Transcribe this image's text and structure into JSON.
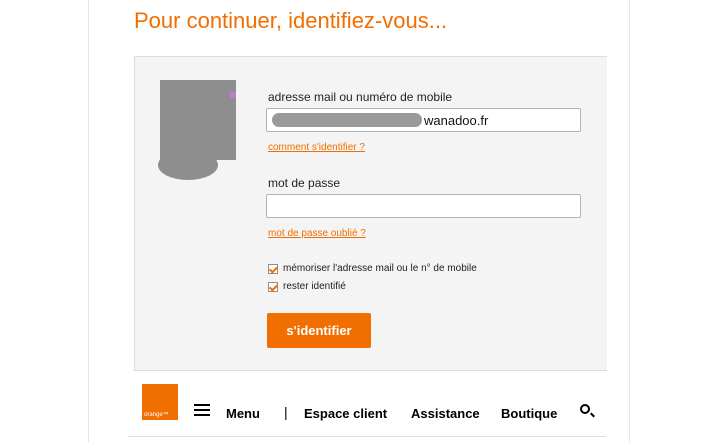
{
  "header": {
    "title": "Pour continuer, identifiez-vous..."
  },
  "login": {
    "email_label": "adresse mail ou numéro de mobile",
    "email_value": "wanadoo.fr",
    "how_to_link": "comment s'identifier ?",
    "password_label": "mot de passe",
    "password_value": "",
    "forgot_link": "mot de passe oublié ?",
    "remember_label": "mémoriser l'adresse mail ou le n° de mobile",
    "stay_label": "rester identifié",
    "submit_label": "s'identifier"
  },
  "nav": {
    "logo_text": "orange™",
    "menu_label": "Menu",
    "separator": "|",
    "items": [
      "Espace client",
      "Assistance",
      "Boutique"
    ]
  },
  "colors": {
    "accent": "#f16e00"
  }
}
